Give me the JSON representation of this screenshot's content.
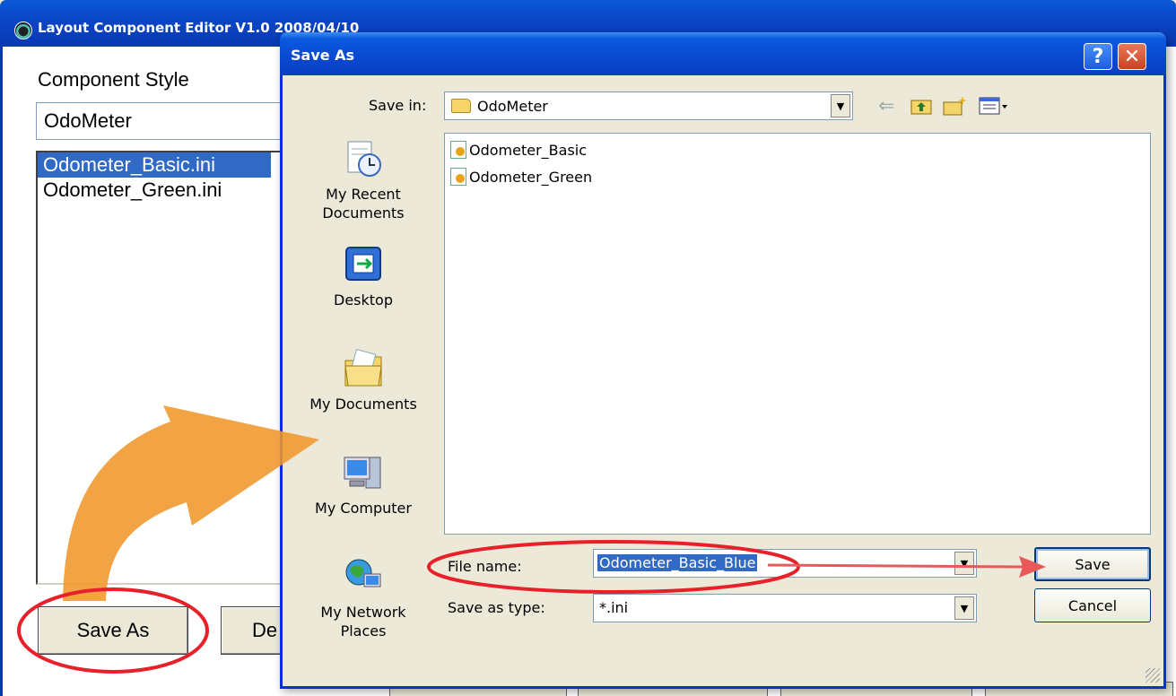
{
  "main_window": {
    "title": "Layout Component Editor V1.0 2008/04/10",
    "component_style_label": "Component Style",
    "component_style_value": "OdoMeter",
    "files": [
      "Odometer_Basic.ini",
      "Odometer_Green.ini"
    ],
    "selected_file": "Odometer_Basic.ini",
    "save_as_button": "Save As",
    "delete_button_partial": "De"
  },
  "dialog": {
    "title": "Save As",
    "help_glyph": "?",
    "close_glyph": "✕",
    "save_in_label": "Save in:",
    "save_in_value": "OdoMeter",
    "places": [
      {
        "label_line1": "My Recent",
        "label_line2": "Documents",
        "icon": "recent-documents-icon"
      },
      {
        "label_line1": "Desktop",
        "label_line2": "",
        "icon": "desktop-icon"
      },
      {
        "label_line1": "My Documents",
        "label_line2": "",
        "icon": "my-documents-icon"
      },
      {
        "label_line1": "My Computer",
        "label_line2": "",
        "icon": "my-computer-icon"
      },
      {
        "label_line1": "My Network",
        "label_line2": "Places",
        "icon": "network-places-icon"
      }
    ],
    "files": [
      "Odometer_Basic",
      "Odometer_Green"
    ],
    "file_name_label": "File name:",
    "file_name_value": "Odometer_Basic_Blue",
    "save_as_type_label": "Save as type:",
    "save_as_type_value": "*.ini",
    "save_button": "Save",
    "cancel_button": "Cancel"
  },
  "colors": {
    "titlebar": "#0a48d0",
    "annotation_arrow": "#f0962a",
    "highlight": "#e8202a",
    "selection": "#3169c6"
  }
}
